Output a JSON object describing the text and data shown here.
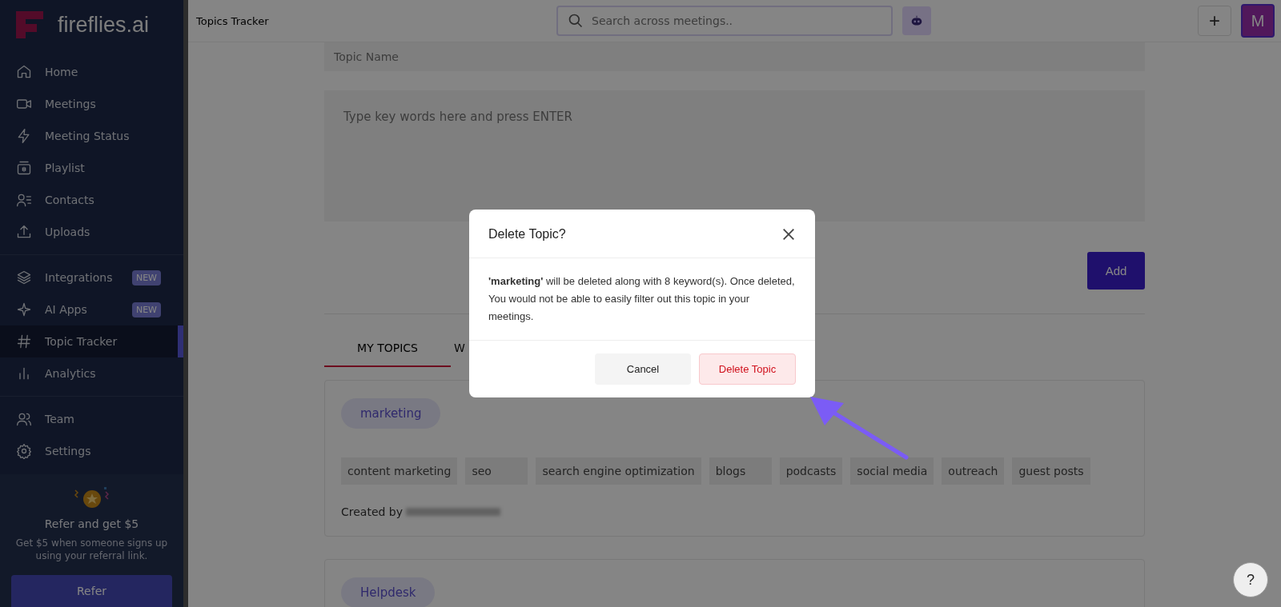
{
  "sidebar": {
    "logo": "fireflies.ai",
    "sections": [
      {
        "items": [
          {
            "label": "Home",
            "selected": false
          },
          {
            "label": "Meetings",
            "selected": false
          },
          {
            "label": "Meeting Status",
            "selected": false
          },
          {
            "label": "Playlist",
            "selected": false
          },
          {
            "label": "Contacts",
            "selected": false
          },
          {
            "label": "Uploads",
            "selected": false
          }
        ]
      },
      {
        "items": [
          {
            "label": "Integrations",
            "selected": false,
            "badge": "NEW"
          },
          {
            "label": "AI Apps",
            "selected": false,
            "badge": "NEW"
          },
          {
            "label": "Topic Tracker",
            "selected": true
          },
          {
            "label": "Analytics",
            "selected": false
          }
        ]
      },
      {
        "items": [
          {
            "label": "Team",
            "selected": false
          },
          {
            "label": "Settings",
            "selected": false
          }
        ]
      }
    ],
    "referral": {
      "title": "Refer and get $5",
      "text": "Get $5 when someone signs up using your referral link.",
      "button": "Refer"
    }
  },
  "header": {
    "title": "Topics Tracker",
    "search": {
      "placeholder": "Search across meetings.."
    },
    "avatar": "M",
    "plus": "+"
  },
  "form": {
    "topic_name": {
      "placeholder": "Topic Name"
    },
    "keywords": {
      "placeholder": "Type key words here and press ENTER"
    },
    "add_button": "Add"
  },
  "tabs": [
    {
      "label": "MY TOPICS",
      "selected": true
    },
    {
      "label": "W",
      "selected": false
    }
  ],
  "topics": [
    {
      "name": "marketing",
      "keywords": [
        "content marketing",
        "seo",
        "search engine optimization",
        "blogs",
        "podcasts",
        "social media",
        "outreach",
        "guest posts"
      ],
      "created_by": "Created by"
    },
    {
      "name": "Helpdesk"
    }
  ],
  "dialog": {
    "title": "Delete Topic?",
    "message": "**'marketing'** will be deleted along with 8 keyword(s). Once deleted, You would not be able to easily filter out this topic in your meetings.",
    "buttons": [
      {
        "label": "Cancel",
        "kind": "secondary"
      },
      {
        "label": "Delete Topic",
        "kind": "danger"
      }
    ]
  },
  "help": "?"
}
